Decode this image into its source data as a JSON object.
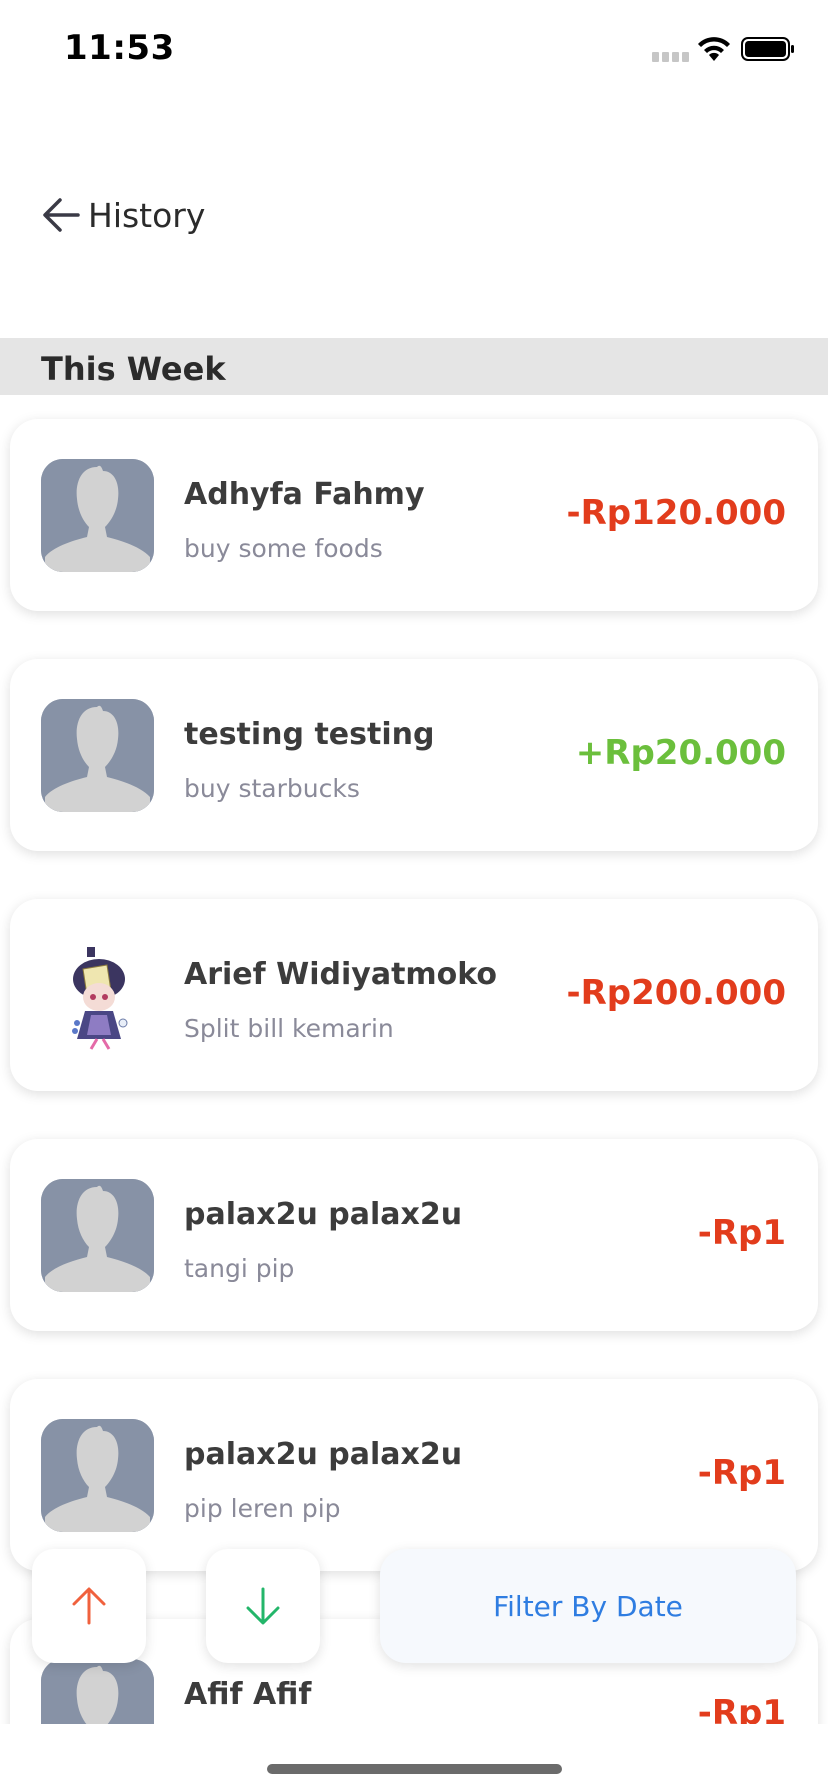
{
  "status_bar": {
    "time": "11:53"
  },
  "header": {
    "title": "History",
    "back_icon": "arrow-left-icon"
  },
  "section": {
    "title": "This Week"
  },
  "transactions": [
    {
      "name": "Adhyfa Fahmy",
      "note": "buy some foods",
      "amount": "-Rp120.000",
      "type": "debit",
      "avatar": "default-avatar"
    },
    {
      "name": "testing testing",
      "note": "buy starbucks",
      "amount": "+Rp20.000",
      "type": "credit",
      "avatar": "default-avatar"
    },
    {
      "name": "Arief Widiyatmoko",
      "note": "Split bill kemarin",
      "amount": "-Rp200.000",
      "type": "debit",
      "avatar": "anime-character-avatar"
    },
    {
      "name": "palax2u palax2u",
      "note": "tangi pip",
      "amount": "-Rp1",
      "type": "debit",
      "avatar": "default-avatar"
    },
    {
      "name": "palax2u palax2u",
      "note": "pip leren pip",
      "amount": "-Rp1",
      "type": "debit",
      "avatar": "default-avatar"
    },
    {
      "name": "Afif Afif",
      "note": "",
      "amount": "-Rp1",
      "type": "debit",
      "avatar": "default-avatar"
    }
  ],
  "controls": {
    "sort_up_icon": "arrow-up-icon",
    "sort_down_icon": "arrow-down-icon",
    "filter_label": "Filter By Date"
  },
  "colors": {
    "debit": "#e23c1c",
    "credit": "#6bbf3c",
    "accent": "#2f7de1",
    "avatar_bg": "#8792a6",
    "section_bg": "#e5e5e5"
  }
}
